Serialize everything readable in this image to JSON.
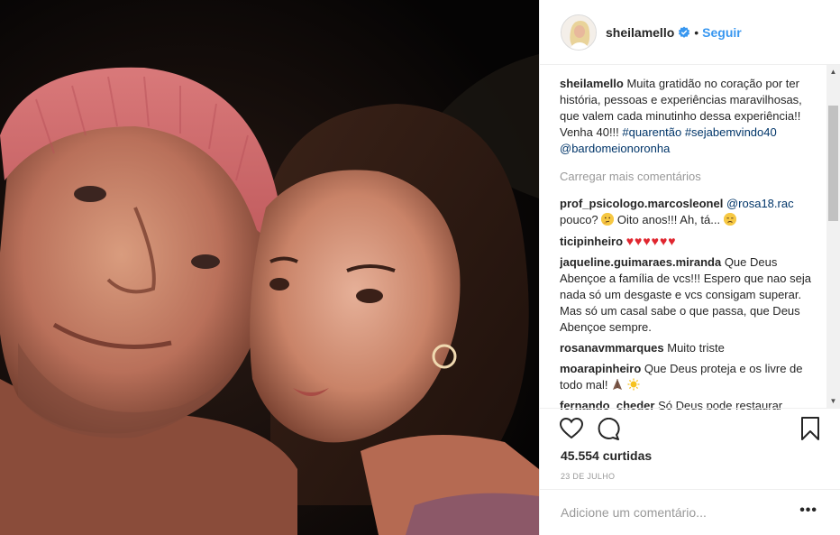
{
  "post": {
    "image_alt": "Selfie noturna de um casal",
    "author": {
      "username": "sheilamello",
      "verified": true,
      "follow_separator": "•",
      "follow_label": "Seguir"
    },
    "caption": {
      "username": "sheilamello",
      "text": "Muita gratidão no coração por ter história, pessoas e experiências maravilhosas, que valem cada minutinho dessa experiência!! Venha 40!!!",
      "tags": [
        "#quarentão",
        "#sejabemvindo40",
        "@bardomeionoronha"
      ]
    },
    "load_more_label": "Carregar mais comentários",
    "comments": [
      {
        "username": "prof_psicologo.marcosleonel",
        "mention": "@rosa18.rac",
        "text": "pouco?",
        "text2": "Oito anos!!! Ah, tá...",
        "emojis": [
          "thinking-face",
          "disappointed-face"
        ]
      },
      {
        "username": "ticipinheiro",
        "text": "♥♥♥♥♥♥",
        "emojis": [
          "red-heart"
        ]
      },
      {
        "username": "jaqueline.guimaraes.miranda",
        "text": "Que Deus Abençoe a família de vcs!!! Espero que nao seja nada só um desgaste e vcs consigam superar. Mas só um casal sabe o que passa, que Deus Abençoe sempre."
      },
      {
        "username": "rosanavmmarques",
        "text": "Muito triste"
      },
      {
        "username": "moarapinheiro",
        "text": "Que Deus proteja e os livre de todo mal!",
        "emojis": [
          "folded-hands",
          "sun"
        ]
      },
      {
        "username": "fernando_cheder",
        "text": "Só Deus pode restaurar"
      }
    ],
    "likes_label": "45.554 curtidas",
    "date_label": "23 DE JULHO",
    "add_comment_placeholder": "Adicione um comentário...",
    "more_options_label": "•••",
    "icons": {
      "like": "heart-outline-icon",
      "comment": "comment-bubble-icon",
      "save": "bookmark-icon",
      "more": "more-options-icon"
    },
    "colors": {
      "link": "#003569",
      "follow": "#3897f0",
      "muted": "#999999",
      "border": "#efefef",
      "verified": "#3897f0"
    }
  }
}
